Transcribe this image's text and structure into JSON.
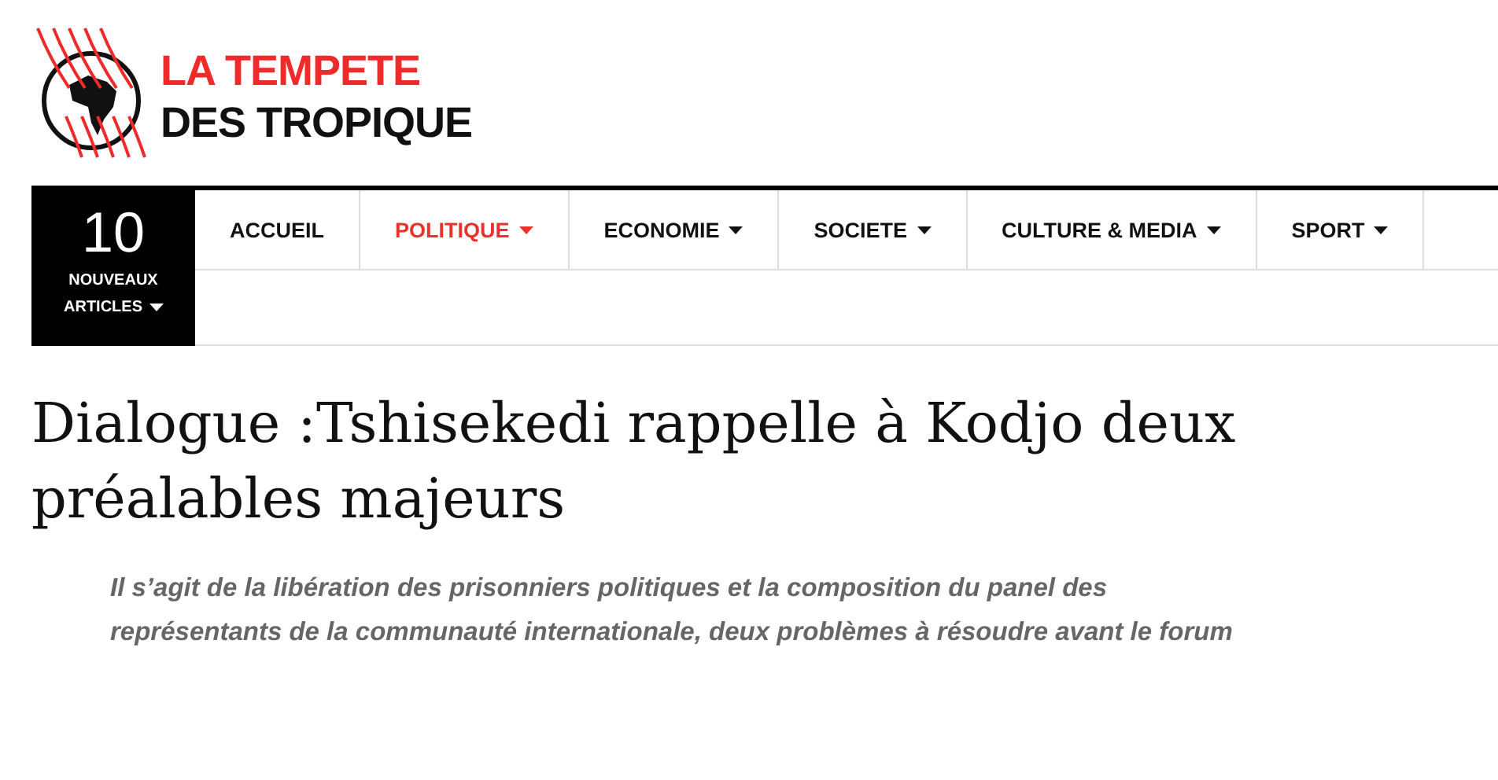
{
  "logo": {
    "line_1": "LA TEMPETE",
    "line_2": "DES TROPIQUE"
  },
  "news_counter": {
    "count": "10",
    "label_1": "NOUVEAUX",
    "label_2": "ARTICLES"
  },
  "nav": [
    {
      "label": "ACCUEIL",
      "selected": false,
      "dropdown": false
    },
    {
      "label": "POLITIQUE",
      "selected": true,
      "dropdown": true
    },
    {
      "label": "ECONOMIE",
      "selected": false,
      "dropdown": true
    },
    {
      "label": "SOCIETE",
      "selected": false,
      "dropdown": true
    },
    {
      "label": "CULTURE & MEDIA",
      "selected": false,
      "dropdown": true
    },
    {
      "label": "SPORT",
      "selected": false,
      "dropdown": true
    }
  ],
  "article": {
    "title": "Dialogue :Tshisekedi rappelle à Kodjo deux préalables majeurs",
    "lead": "Il s’agit de la libération des prisonniers politiques et la composition du panel des représentants de la communauté internationale, deux problèmes à résoudre avant le forum"
  }
}
